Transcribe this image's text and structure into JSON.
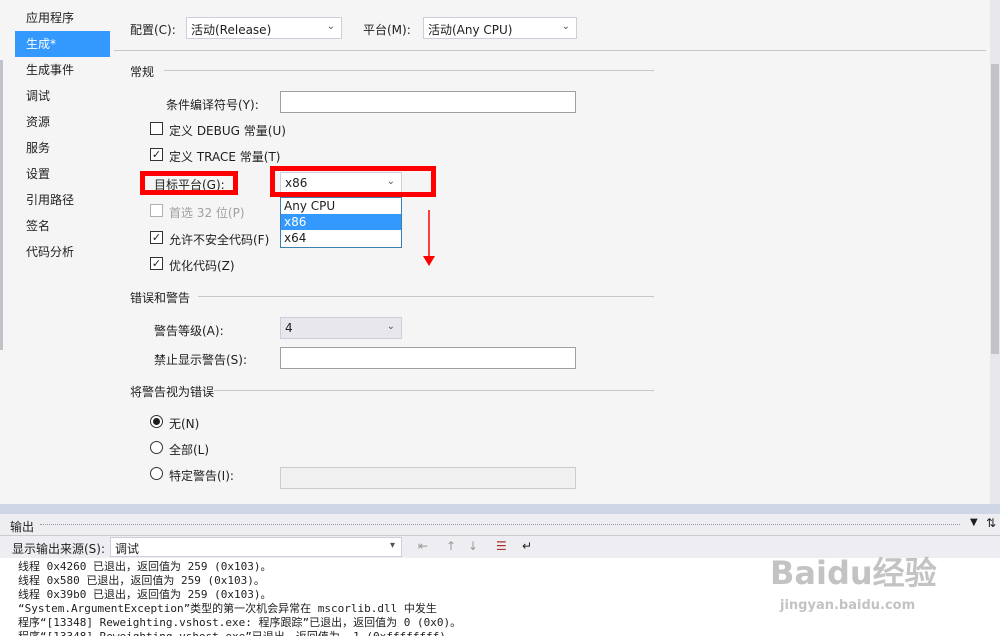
{
  "sidebar": {
    "items": [
      {
        "label": "应用程序"
      },
      {
        "label": "生成*"
      },
      {
        "label": "生成事件"
      },
      {
        "label": "调试"
      },
      {
        "label": "资源"
      },
      {
        "label": "服务"
      },
      {
        "label": "设置"
      },
      {
        "label": "引用路径"
      },
      {
        "label": "签名"
      },
      {
        "label": "代码分析"
      }
    ],
    "active_index": 1
  },
  "config": {
    "config_label": "配置(C):",
    "config_value": "活动(Release)",
    "platform_label": "平台(M):",
    "platform_value": "活动(Any CPU)"
  },
  "general": {
    "section_title": "常规",
    "conditional_symbols_label": "条件编译符号(Y):",
    "conditional_symbols_value": "",
    "define_debug_label": "定义 DEBUG 常量(U)",
    "define_debug_checked": false,
    "define_trace_label": "定义 TRACE 常量(T)",
    "define_trace_checked": true,
    "target_platform_label": "目标平台(G):",
    "target_platform_value": "x86",
    "target_platform_options": [
      "Any CPU",
      "x86",
      "x64"
    ],
    "target_platform_selected_index": 1,
    "prefer32_label": "首选 32 位(P)",
    "prefer32_checked": false,
    "allow_unsafe_label": "允许不安全代码(F)",
    "allow_unsafe_checked": true,
    "optimize_label": "优化代码(Z)",
    "optimize_checked": true
  },
  "errors": {
    "section_title": "错误和警告",
    "warning_level_label": "警告等级(A):",
    "warning_level_value": "4",
    "suppress_label": "禁止显示警告(S):",
    "suppress_value": ""
  },
  "treat_warnings": {
    "section_title": "将警告视为错误",
    "none_label": "无(N)",
    "all_label": "全部(L)",
    "specific_label": "特定警告(I):",
    "selected": "none"
  },
  "output": {
    "title": "输出",
    "source_label": "显示输出来源(S):",
    "source_value": "调试",
    "lines": [
      "线程 0x4260 已退出，返回值为 259 (0x103)。",
      "线程 0x580 已退出，返回值为 259 (0x103)。",
      "线程 0x39b0 已退出，返回值为 259 (0x103)。",
      "“System.ArgumentException”类型的第一次机会异常在 mscorlib.dll 中发生",
      "程序“[13348] Reweighting.vshost.exe: 程序跟踪”已退出，返回值为 0 (0x0)。",
      "程序“[13348] Reweighting.vshost.exe”已退出，返回值为 -1 (0xffffffff)。"
    ]
  },
  "watermark": {
    "brand": "Baidu经验",
    "url": "jingyan.baidu.com"
  },
  "colors": {
    "accent": "#3399ff",
    "highlight_red": "#ff0000"
  }
}
